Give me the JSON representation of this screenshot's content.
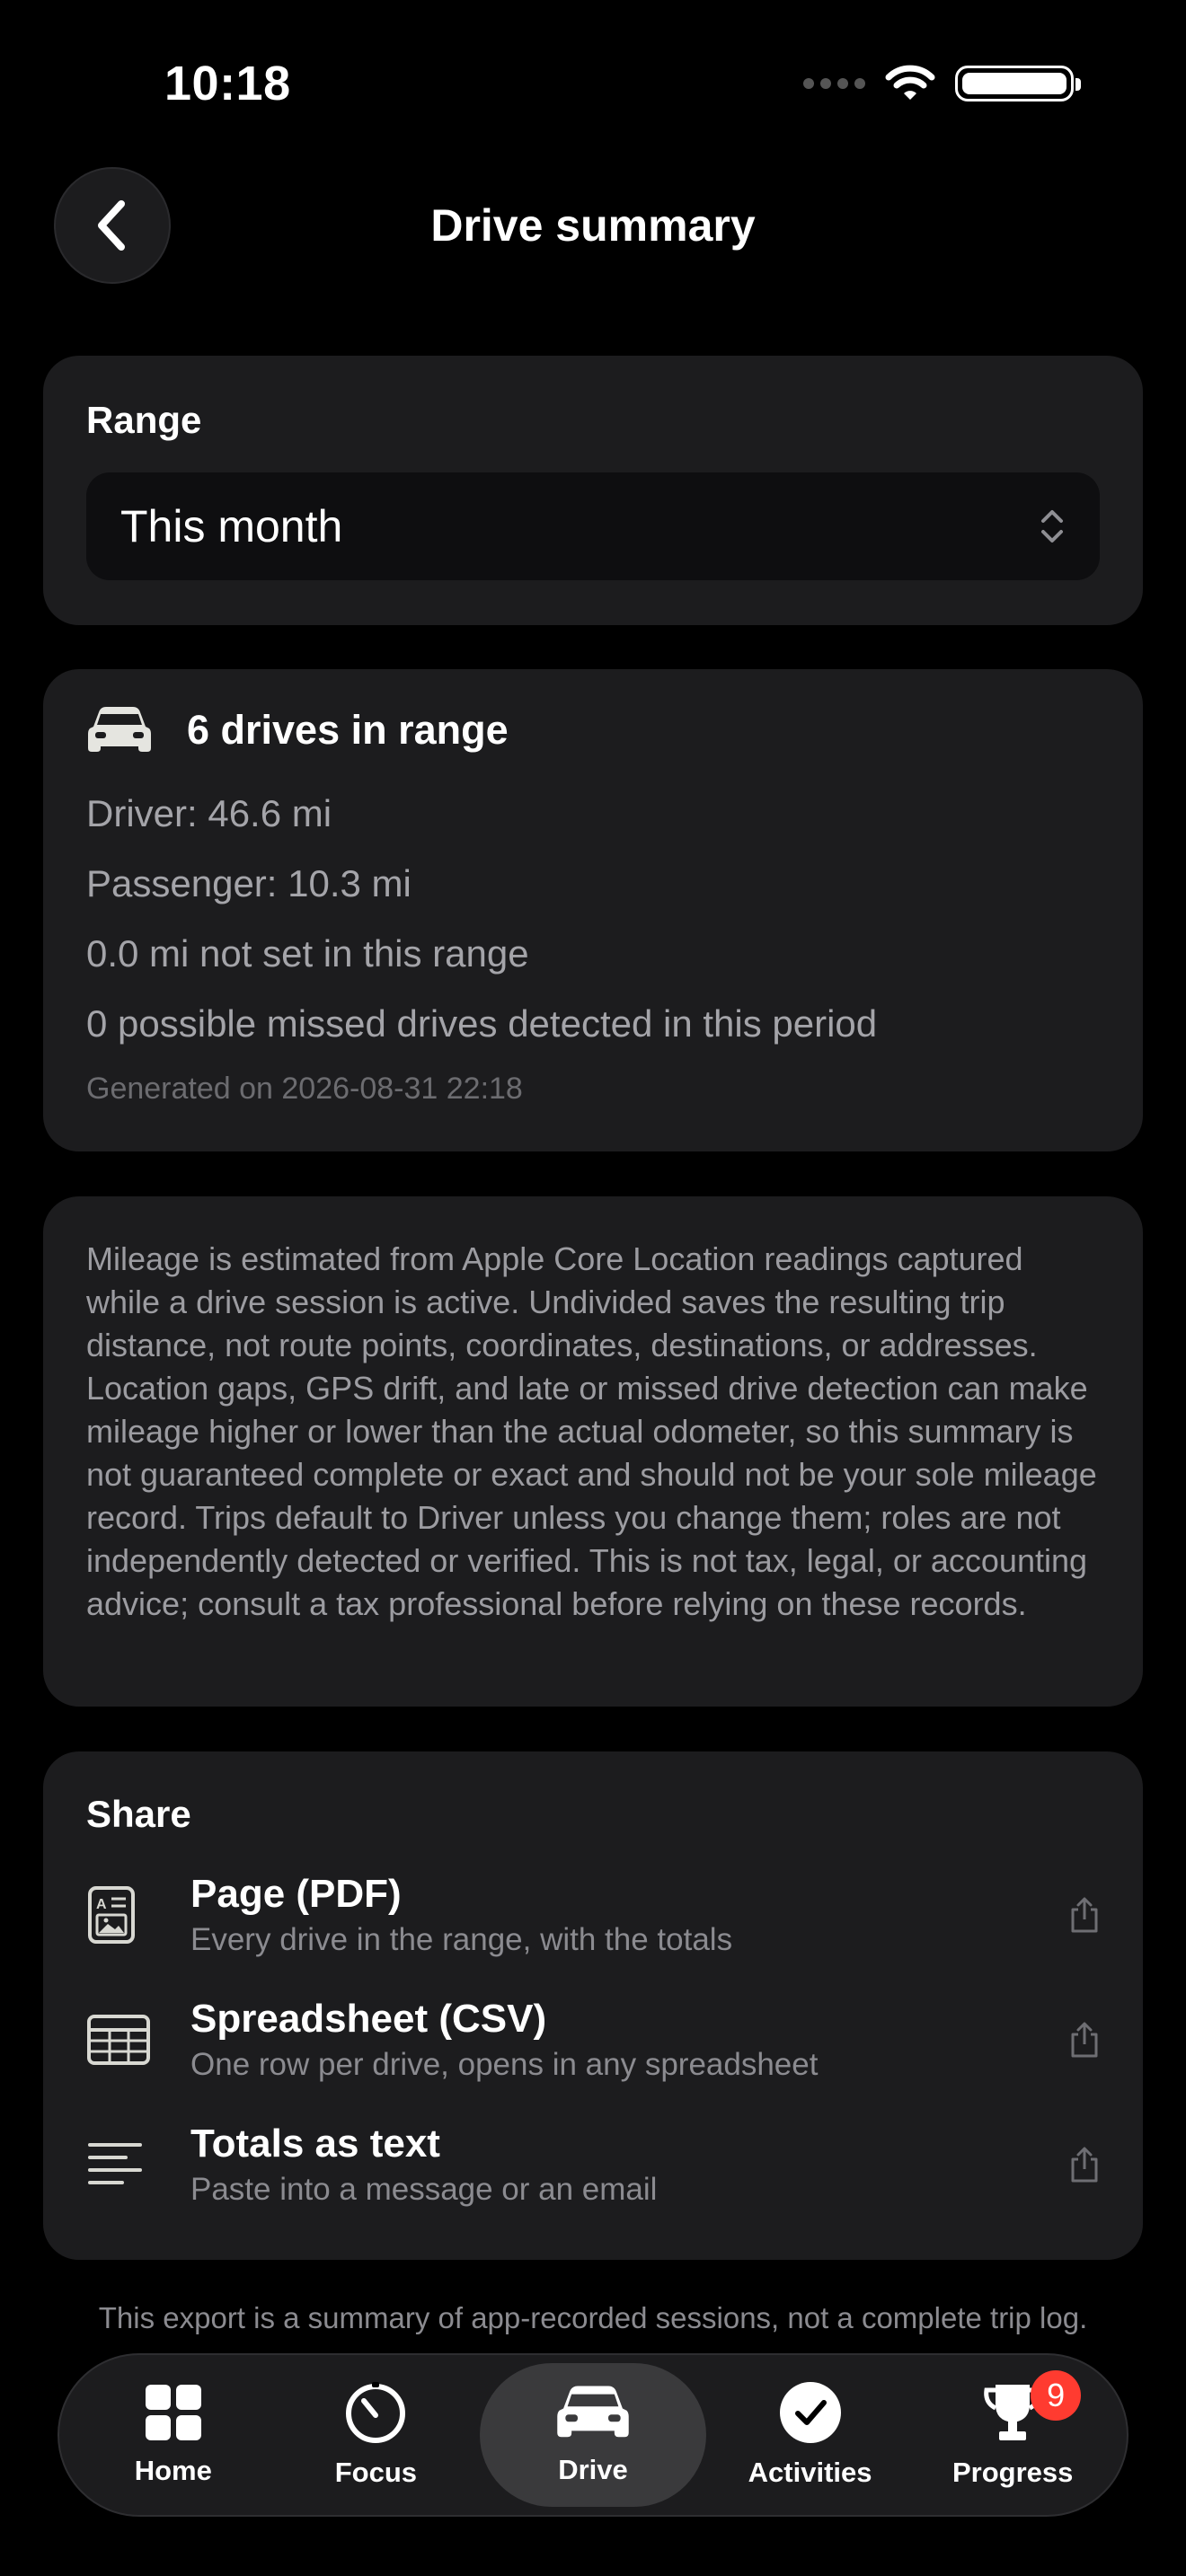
{
  "status_bar": {
    "time": "10:18"
  },
  "nav": {
    "title": "Drive summary"
  },
  "range": {
    "label": "Range",
    "selected": "This month"
  },
  "summary": {
    "title": "6 drives in range",
    "driver": "Driver: 46.6 mi",
    "passenger": "Passenger: 10.3 mi",
    "not_set": "0.0 mi not set in this range",
    "missed": "0 possible missed drives detected in this period",
    "generated": "Generated on 2026-08-31 22:18"
  },
  "disclaimer": "Mileage is estimated from Apple Core Location readings captured while a drive session is active. Undivided saves the resulting trip distance, not route points, coordinates, destinations, or addresses. Location gaps, GPS drift, and late or missed drive detection can make mileage higher or lower than the actual odometer, so this summary is not guaranteed complete or exact and should not be your sole mileage record. Trips default to Driver unless you change them; roles are not independently detected or verified. This is not tax, legal, or accounting advice; consult a tax professional before relying on these records.",
  "share": {
    "heading": "Share",
    "items": [
      {
        "title": "Page (PDF)",
        "subtitle": "Every drive in the range, with the totals",
        "icon": "document-icon"
      },
      {
        "title": "Spreadsheet (CSV)",
        "subtitle": "One row per drive, opens in any spreadsheet",
        "icon": "table-icon"
      },
      {
        "title": "Totals as text",
        "subtitle": "Paste into a message or an email",
        "icon": "text-lines-icon"
      }
    ]
  },
  "footer_note": "This export is a summary of app-recorded sessions, not a complete trip log.",
  "tabs": [
    {
      "label": "Home",
      "icon": "grid-icon"
    },
    {
      "label": "Focus",
      "icon": "timer-icon"
    },
    {
      "label": "Drive",
      "icon": "car-icon",
      "active": true
    },
    {
      "label": "Activities",
      "icon": "check-circle-icon"
    },
    {
      "label": "Progress",
      "icon": "trophy-icon",
      "badge": "9"
    }
  ],
  "colors": {
    "background": "#000000",
    "card": "#1c1c1e",
    "badge": "#ff3b30"
  }
}
